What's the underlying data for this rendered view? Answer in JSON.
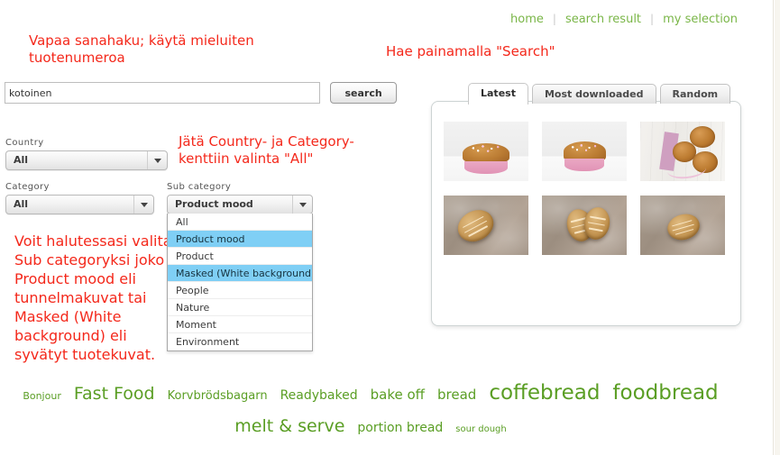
{
  "topnav": {
    "links": [
      {
        "label": "home"
      },
      {
        "label": "search result"
      },
      {
        "label": "my selection"
      }
    ],
    "separator": "|"
  },
  "annotations": {
    "free_text_search": "Vapaa sanahaku; käytä mieluiten\ntuotenumeroa",
    "press_search": "Hae painamalla \"Search\"",
    "leave_all": "Jätä Country- ja Category-\nkenttiin valinta \"All\"",
    "sub_category_help": "Voit halutessasi valita\nSub categoryksi joko\nProduct mood eli\ntunnelmakuvat tai\nMasked (White\nbackground) eli\nsyvätyt tuotekuvat."
  },
  "search": {
    "value": "kotoinen",
    "placeholder": "",
    "button_label": "search"
  },
  "filters": {
    "country": {
      "label": "Country",
      "value": "All"
    },
    "category": {
      "label": "Category",
      "value": "All"
    },
    "sub_category": {
      "label": "Sub category",
      "value": "Product mood",
      "open": true,
      "options": [
        {
          "label": "All",
          "highlighted": false
        },
        {
          "label": "Product mood",
          "highlighted": true
        },
        {
          "label": "Product",
          "highlighted": false
        },
        {
          "label": "Masked (White background)",
          "highlighted": true
        },
        {
          "label": "People",
          "highlighted": false
        },
        {
          "label": "Nature",
          "highlighted": false
        },
        {
          "label": "Moment",
          "highlighted": false
        },
        {
          "label": "Environment",
          "highlighted": false
        }
      ]
    }
  },
  "results": {
    "tabs": [
      {
        "label": "Latest",
        "active": true
      },
      {
        "label": "Most downloaded",
        "active": false
      },
      {
        "label": "Random",
        "active": false
      }
    ],
    "thumbnails": [
      {
        "alt": "muffin-with-sprinkles-in-pink-case",
        "style": "muffin"
      },
      {
        "alt": "muffin-with-sprinkles-in-pink-case-closeup",
        "style": "muffin-small"
      },
      {
        "alt": "pastries-on-white-wooden-board-with-pink-ribbon",
        "style": "board"
      },
      {
        "alt": "rustic-scored-loaf-on-floured-stone",
        "style": "loaf-a"
      },
      {
        "alt": "two-rustic-scored-loaves-on-floured-stone",
        "style": "loaf-b"
      },
      {
        "alt": "small-rustic-scored-loaf-on-floured-stone",
        "style": "loaf-c"
      }
    ]
  },
  "tag_cloud": {
    "row1": [
      {
        "label": "Bonjour",
        "size": 11
      },
      {
        "label": "Fast Food",
        "size": 19
      },
      {
        "label": "Korvbrödsbagarn",
        "size": 13
      },
      {
        "label": "Readybaked",
        "size": 14
      },
      {
        "label": "bake off",
        "size": 15
      },
      {
        "label": "bread",
        "size": 15
      },
      {
        "label": "coffebread",
        "size": 23
      },
      {
        "label": "foodbread",
        "size": 23
      }
    ],
    "row2": [
      {
        "label": "melt & serve",
        "size": 19
      },
      {
        "label": "portion bread",
        "size": 14
      },
      {
        "label": "sour dough",
        "size": 10
      }
    ]
  },
  "colors": {
    "annotation_red": "#f4281b",
    "nav_green": "#7ab648",
    "tag_green": "#5a9e24",
    "dropdown_highlight": "#7fcff5"
  }
}
